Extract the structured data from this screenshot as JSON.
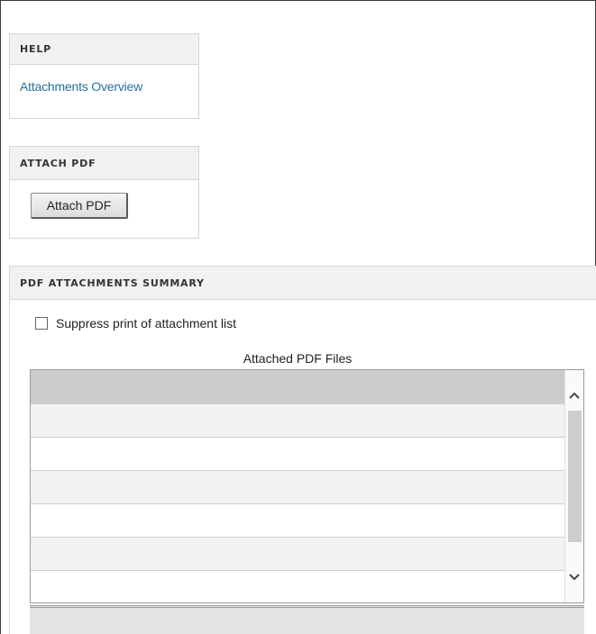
{
  "help": {
    "title": "HELP",
    "link_label": "Attachments Overview"
  },
  "attach": {
    "title": "ATTACH PDF",
    "button_label": "Attach PDF"
  },
  "summary": {
    "title": "PDF ATTACHMENTS SUMMARY",
    "suppress_label": "Suppress print of attachment list",
    "suppress_checked": false,
    "table_caption": "Attached PDF Files",
    "rows": [
      "",
      "",
      "",
      "",
      "",
      ""
    ]
  },
  "icons": {
    "scroll_up": "chevron-up-icon",
    "scroll_down": "chevron-down-icon"
  },
  "colors": {
    "link": "#2a6f9e",
    "header_bg": "#f1f1f1",
    "list_header_bg": "#cccccc"
  }
}
